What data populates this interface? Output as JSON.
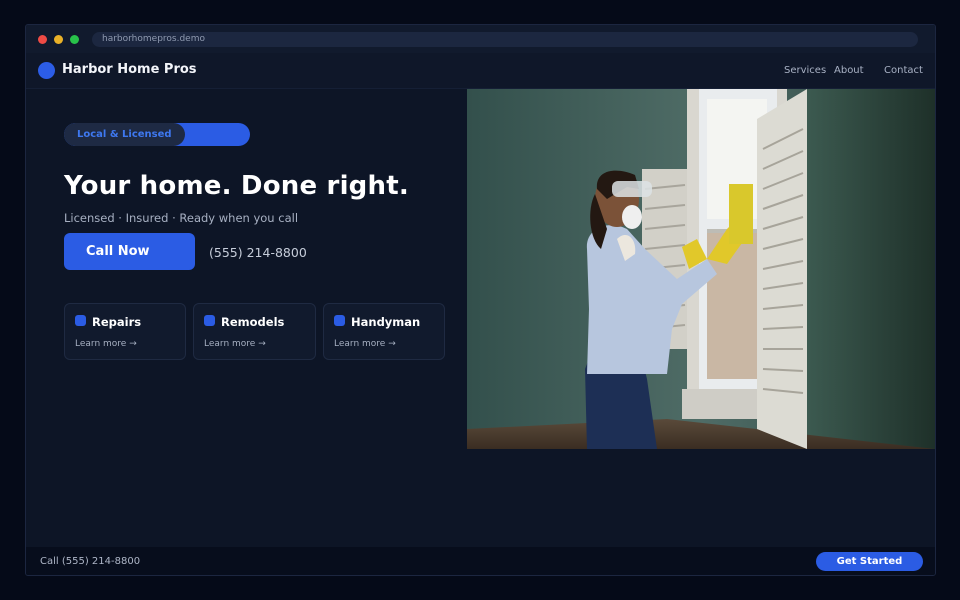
{
  "browser": {
    "url": "harborhomepros.demo"
  },
  "nav": {
    "brand": "Harbor Home Pros",
    "links": [
      "Services",
      "About",
      "Contact"
    ]
  },
  "hero": {
    "badge": "Local & Licensed",
    "headline": "Your home. Done right.",
    "subtitle": "Licensed · Insured · Ready when you call",
    "cta_label": "Call Now",
    "phone": "(555) 214-8800"
  },
  "services": [
    {
      "title": "Repairs",
      "link": "Learn more →"
    },
    {
      "title": "Remodels",
      "link": "Learn more →"
    },
    {
      "title": "Handyman",
      "link": "Learn more →"
    }
  ],
  "footer": {
    "call_text": "Call (555) 214-8800",
    "cta_label": "Get Started"
  },
  "colors": {
    "accent": "#2b5ce4",
    "background": "#0d1526",
    "footer": "#070d1c"
  }
}
